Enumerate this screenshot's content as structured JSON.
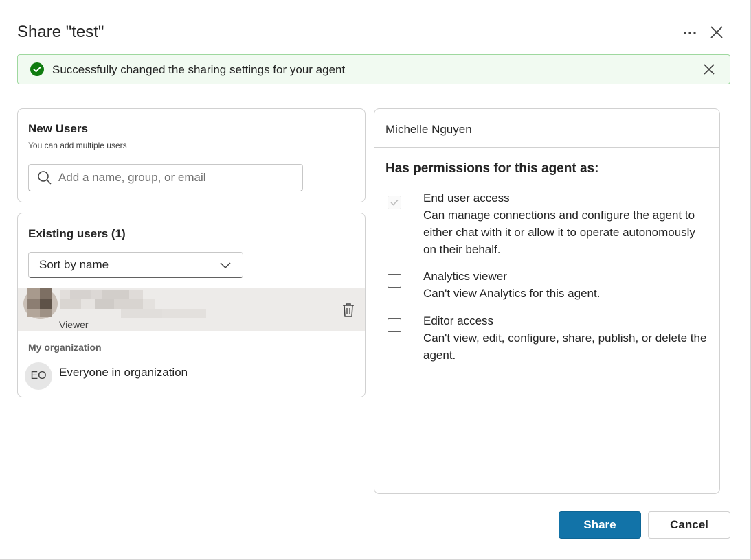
{
  "dialog": {
    "title": "Share \"test\"",
    "more_icon": "more-horizontal-icon",
    "close_icon": "close-icon"
  },
  "banner": {
    "message": "Successfully changed the sharing settings for your agent",
    "status_color": "#107c10"
  },
  "new_users": {
    "heading": "New Users",
    "subtext": "You can add multiple users",
    "search_placeholder": "Add a name, group, or email",
    "search_value": ""
  },
  "existing_users": {
    "heading": "Existing users (1)",
    "sort_selected": "Sort by name",
    "users": [
      {
        "role": "Viewer"
      }
    ],
    "org_heading": "My organization",
    "org_initials": "EO",
    "org_name": "Everyone in organization"
  },
  "permissions": {
    "user_name": "Michelle Nguyen",
    "title": "Has permissions for this agent as:",
    "items": [
      {
        "label": "End user access",
        "description": "Can manage connections and configure the agent to either chat with it or allow it to operate autonomously on their behalf.",
        "checked": true,
        "disabled": true
      },
      {
        "label": "Analytics viewer",
        "description": "Can't view Analytics for this agent.",
        "checked": false,
        "disabled": false
      },
      {
        "label": "Editor access",
        "description": "Can't view, edit, configure, share, publish, or delete the agent.",
        "checked": false,
        "disabled": false
      }
    ]
  },
  "footer": {
    "share_label": "Share",
    "cancel_label": "Cancel",
    "primary_color": "#1273a8"
  }
}
